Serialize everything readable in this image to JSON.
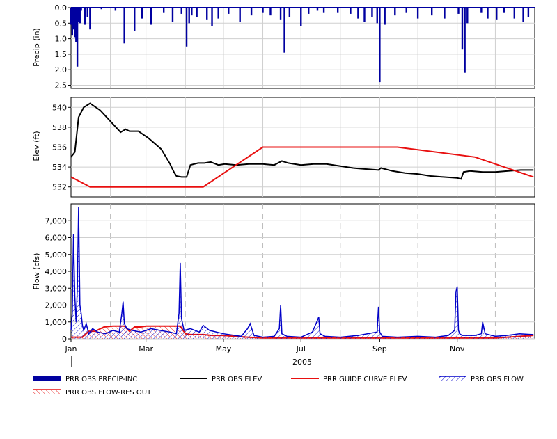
{
  "chart_data": [
    {
      "type": "bar",
      "name": "precip-panel",
      "ylabel": "Precip (in)",
      "ylim": [
        0,
        2.6
      ],
      "y_inverted": true,
      "y_ticks": [
        0.0,
        0.5,
        1.0,
        1.5,
        2.0,
        2.5
      ],
      "y_tick_labels": [
        "0.0",
        "0.5",
        "1.0",
        "1.5",
        "2.0",
        "2.5"
      ],
      "grid": true,
      "series": [
        {
          "name": "PRR OBS PRECIP-INC",
          "color": "#0000a0",
          "x": [
            "2005-01-01",
            "2005-01-02",
            "2005-01-03",
            "2005-01-04",
            "2005-01-05",
            "2005-01-06",
            "2005-01-07",
            "2005-01-08",
            "2005-01-09",
            "2005-01-12",
            "2005-01-14",
            "2005-01-16",
            "2005-01-25",
            "2005-02-05",
            "2005-02-12",
            "2005-02-20",
            "2005-02-26",
            "2005-03-05",
            "2005-03-15",
            "2005-03-22",
            "2005-03-29",
            "2005-04-02",
            "2005-04-04",
            "2005-04-06",
            "2005-04-10",
            "2005-04-18",
            "2005-04-22",
            "2005-04-27",
            "2005-05-05",
            "2005-05-14",
            "2005-05-23",
            "2005-06-01",
            "2005-06-07",
            "2005-06-15",
            "2005-06-18",
            "2005-06-22",
            "2005-07-01",
            "2005-07-07",
            "2005-07-14",
            "2005-07-19",
            "2005-07-30",
            "2005-08-09",
            "2005-08-15",
            "2005-08-20",
            "2005-08-26",
            "2005-08-30",
            "2005-09-01",
            "2005-09-05",
            "2005-09-13",
            "2005-09-22",
            "2005-10-01",
            "2005-10-12",
            "2005-10-22",
            "2005-11-02",
            "2005-11-05",
            "2005-11-07",
            "2005-11-09",
            "2005-11-20",
            "2005-11-25",
            "2005-12-02",
            "2005-12-08",
            "2005-12-16",
            "2005-12-23",
            "2005-12-27"
          ],
          "values": [
            0.55,
            0.9,
            0.7,
            0.95,
            1.1,
            1.9,
            0.45,
            0.5,
            0.1,
            0.55,
            0.3,
            0.7,
            0.05,
            0.1,
            1.15,
            0.75,
            0.35,
            0.55,
            0.15,
            0.45,
            0.2,
            1.25,
            0.5,
            0.25,
            0.3,
            0.4,
            0.6,
            0.35,
            0.2,
            0.45,
            0.25,
            0.15,
            0.25,
            0.4,
            1.45,
            0.3,
            0.6,
            0.2,
            0.1,
            0.15,
            0.15,
            0.2,
            0.35,
            0.45,
            0.3,
            0.5,
            2.4,
            0.55,
            0.25,
            0.15,
            0.35,
            0.25,
            0.35,
            0.2,
            1.35,
            2.1,
            0.5,
            0.15,
            0.35,
            0.4,
            0.15,
            0.35,
            0.45,
            0.3
          ]
        }
      ]
    },
    {
      "type": "line",
      "name": "elev-panel",
      "ylabel": "Elev (ft)",
      "ylim": [
        531,
        541
      ],
      "y_ticks": [
        532,
        534,
        536,
        538,
        540
      ],
      "y_tick_labels": [
        "532",
        "534",
        "536",
        "538",
        "540"
      ],
      "grid": true,
      "series": [
        {
          "name": "PRR OBS ELEV",
          "color": "#000000",
          "x": [
            "2005-01-01",
            "2005-01-04",
            "2005-01-07",
            "2005-01-11",
            "2005-01-16",
            "2005-01-24",
            "2005-02-01",
            "2005-02-09",
            "2005-02-13",
            "2005-02-16",
            "2005-02-23",
            "2005-03-03",
            "2005-03-13",
            "2005-03-20",
            "2005-03-23",
            "2005-03-25",
            "2005-03-29",
            "2005-04-02",
            "2005-04-05",
            "2005-04-11",
            "2005-04-16",
            "2005-04-21",
            "2005-04-27",
            "2005-05-02",
            "2005-05-11",
            "2005-05-21",
            "2005-06-01",
            "2005-06-10",
            "2005-06-16",
            "2005-06-21",
            "2005-07-01",
            "2005-07-11",
            "2005-07-21",
            "2005-08-01",
            "2005-08-11",
            "2005-08-21",
            "2005-08-31",
            "2005-09-02",
            "2005-09-11",
            "2005-09-21",
            "2005-10-01",
            "2005-10-11",
            "2005-10-21",
            "2005-11-01",
            "2005-11-04",
            "2005-11-06",
            "2005-11-11",
            "2005-11-21",
            "2005-12-01",
            "2005-12-11",
            "2005-12-21",
            "2005-12-31"
          ],
          "values": [
            535.0,
            535.5,
            539.0,
            540.0,
            540.4,
            539.7,
            538.6,
            537.5,
            537.8,
            537.6,
            537.6,
            536.9,
            535.8,
            534.3,
            533.5,
            533.1,
            533.0,
            533.0,
            534.2,
            534.4,
            534.4,
            534.5,
            534.2,
            534.3,
            534.2,
            534.3,
            534.3,
            534.2,
            534.6,
            534.4,
            534.2,
            534.3,
            534.3,
            534.1,
            533.9,
            533.8,
            533.7,
            533.9,
            533.6,
            533.4,
            533.3,
            533.1,
            533.0,
            532.9,
            532.8,
            533.5,
            533.6,
            533.5,
            533.5,
            533.6,
            533.7,
            533.7
          ]
        },
        {
          "name": "PRR GUIDE CURVE ELEV",
          "color": "#e81010",
          "x": [
            "2005-01-01",
            "2005-01-16",
            "2005-04-15",
            "2005-06-01",
            "2005-09-15",
            "2005-11-15",
            "2005-12-31"
          ],
          "values": [
            533.0,
            532.0,
            532.0,
            536.0,
            536.0,
            535.0,
            533.0
          ]
        }
      ]
    },
    {
      "type": "area",
      "name": "flow-panel",
      "ylabel": "Flow (cfs)",
      "ylim": [
        0,
        8000
      ],
      "y_ticks": [
        0,
        1000,
        2000,
        3000,
        4000,
        5000,
        6000,
        7000
      ],
      "y_tick_labels": [
        "0",
        "1,000",
        "2,000",
        "3,000",
        "4,000",
        "5,000",
        "6,000",
        "7,000"
      ],
      "x_tick_labels": [
        "Jan",
        "Mar",
        "May",
        "Jul",
        "Sep",
        "Nov"
      ],
      "x_ticks": [
        "2005-01-01",
        "2005-03-01",
        "2005-05-01",
        "2005-07-01",
        "2005-09-01",
        "2005-11-01"
      ],
      "xlabel": "2005",
      "grid": true,
      "series": [
        {
          "name": "PRR OBS FLOW",
          "color": "#0000c8",
          "x": [
            "2005-01-01",
            "2005-01-02",
            "2005-01-03",
            "2005-01-04",
            "2005-01-05",
            "2005-01-06",
            "2005-01-07",
            "2005-01-08",
            "2005-01-09",
            "2005-01-10",
            "2005-01-11",
            "2005-01-13",
            "2005-01-15",
            "2005-01-18",
            "2005-01-22",
            "2005-01-28",
            "2005-02-03",
            "2005-02-08",
            "2005-02-10",
            "2005-02-11",
            "2005-02-12",
            "2005-02-14",
            "2005-02-18",
            "2005-02-25",
            "2005-03-05",
            "2005-03-12",
            "2005-03-20",
            "2005-03-25",
            "2005-03-27",
            "2005-03-28",
            "2005-03-29",
            "2005-03-31",
            "2005-04-05",
            "2005-04-12",
            "2005-04-15",
            "2005-04-20",
            "2005-05-01",
            "2005-05-10",
            "2005-05-15",
            "2005-05-20",
            "2005-05-22",
            "2005-05-25",
            "2005-06-01",
            "2005-06-10",
            "2005-06-14",
            "2005-06-15",
            "2005-06-16",
            "2005-06-20",
            "2005-07-01",
            "2005-07-10",
            "2005-07-14",
            "2005-07-15",
            "2005-07-16",
            "2005-07-20",
            "2005-08-01",
            "2005-08-15",
            "2005-08-30",
            "2005-08-31",
            "2005-09-01",
            "2005-09-03",
            "2005-09-15",
            "2005-10-01",
            "2005-10-15",
            "2005-10-25",
            "2005-10-30",
            "2005-10-31",
            "2005-11-01",
            "2005-11-02",
            "2005-11-03",
            "2005-11-05",
            "2005-11-15",
            "2005-11-20",
            "2005-11-21",
            "2005-11-23",
            "2005-12-01",
            "2005-12-10",
            "2005-12-20",
            "2005-12-31"
          ],
          "values": [
            500,
            1500,
            6200,
            2500,
            1000,
            3000,
            7800,
            2000,
            1500,
            800,
            500,
            900,
            300,
            600,
            400,
            300,
            500,
            400,
            1500,
            2200,
            900,
            600,
            500,
            400,
            600,
            500,
            400,
            300,
            1500,
            4500,
            1200,
            500,
            600,
            400,
            800,
            500,
            300,
            200,
            150,
            600,
            900,
            200,
            100,
            150,
            600,
            2000,
            300,
            150,
            100,
            400,
            1100,
            1300,
            300,
            150,
            100,
            200,
            400,
            1900,
            400,
            150,
            100,
            150,
            100,
            200,
            500,
            2800,
            3100,
            500,
            300,
            200,
            200,
            300,
            1000,
            300,
            150,
            200,
            300,
            250
          ]
        },
        {
          "name": "PRR OBS FLOW-RES OUT",
          "color": "#e81010",
          "x": [
            "2005-01-01",
            "2005-01-10",
            "2005-01-15",
            "2005-01-20",
            "2005-01-27",
            "2005-02-03",
            "2005-02-12",
            "2005-02-16",
            "2005-02-20",
            "2005-02-25",
            "2005-03-01",
            "2005-03-10",
            "2005-03-17",
            "2005-03-22",
            "2005-03-28",
            "2005-04-01",
            "2005-04-05",
            "2005-04-15",
            "2005-04-22",
            "2005-05-01",
            "2005-05-10",
            "2005-05-20",
            "2005-06-01",
            "2005-07-01",
            "2005-08-01",
            "2005-09-01",
            "2005-10-01",
            "2005-11-01",
            "2005-12-01",
            "2005-12-31"
          ],
          "values": [
            100,
            100,
            450,
            450,
            700,
            750,
            750,
            450,
            700,
            700,
            750,
            750,
            750,
            750,
            750,
            300,
            250,
            250,
            200,
            200,
            150,
            100,
            50,
            50,
            50,
            50,
            50,
            50,
            50,
            200
          ]
        }
      ]
    }
  ],
  "legend": [
    {
      "label": "PRR OBS PRECIP-INC",
      "color": "#0000a0",
      "style": "thick-line"
    },
    {
      "label": "PRR OBS ELEV",
      "color": "#000000",
      "style": "line"
    },
    {
      "label": "PRR GUIDE CURVE ELEV",
      "color": "#e81010",
      "style": "line"
    },
    {
      "label": "PRR OBS FLOW",
      "color": "#0000c8",
      "style": "hatched"
    },
    {
      "label": "PRR OBS FLOW-RES OUT",
      "color": "#e81010",
      "style": "hatched"
    }
  ],
  "legend_placement": "bottom"
}
